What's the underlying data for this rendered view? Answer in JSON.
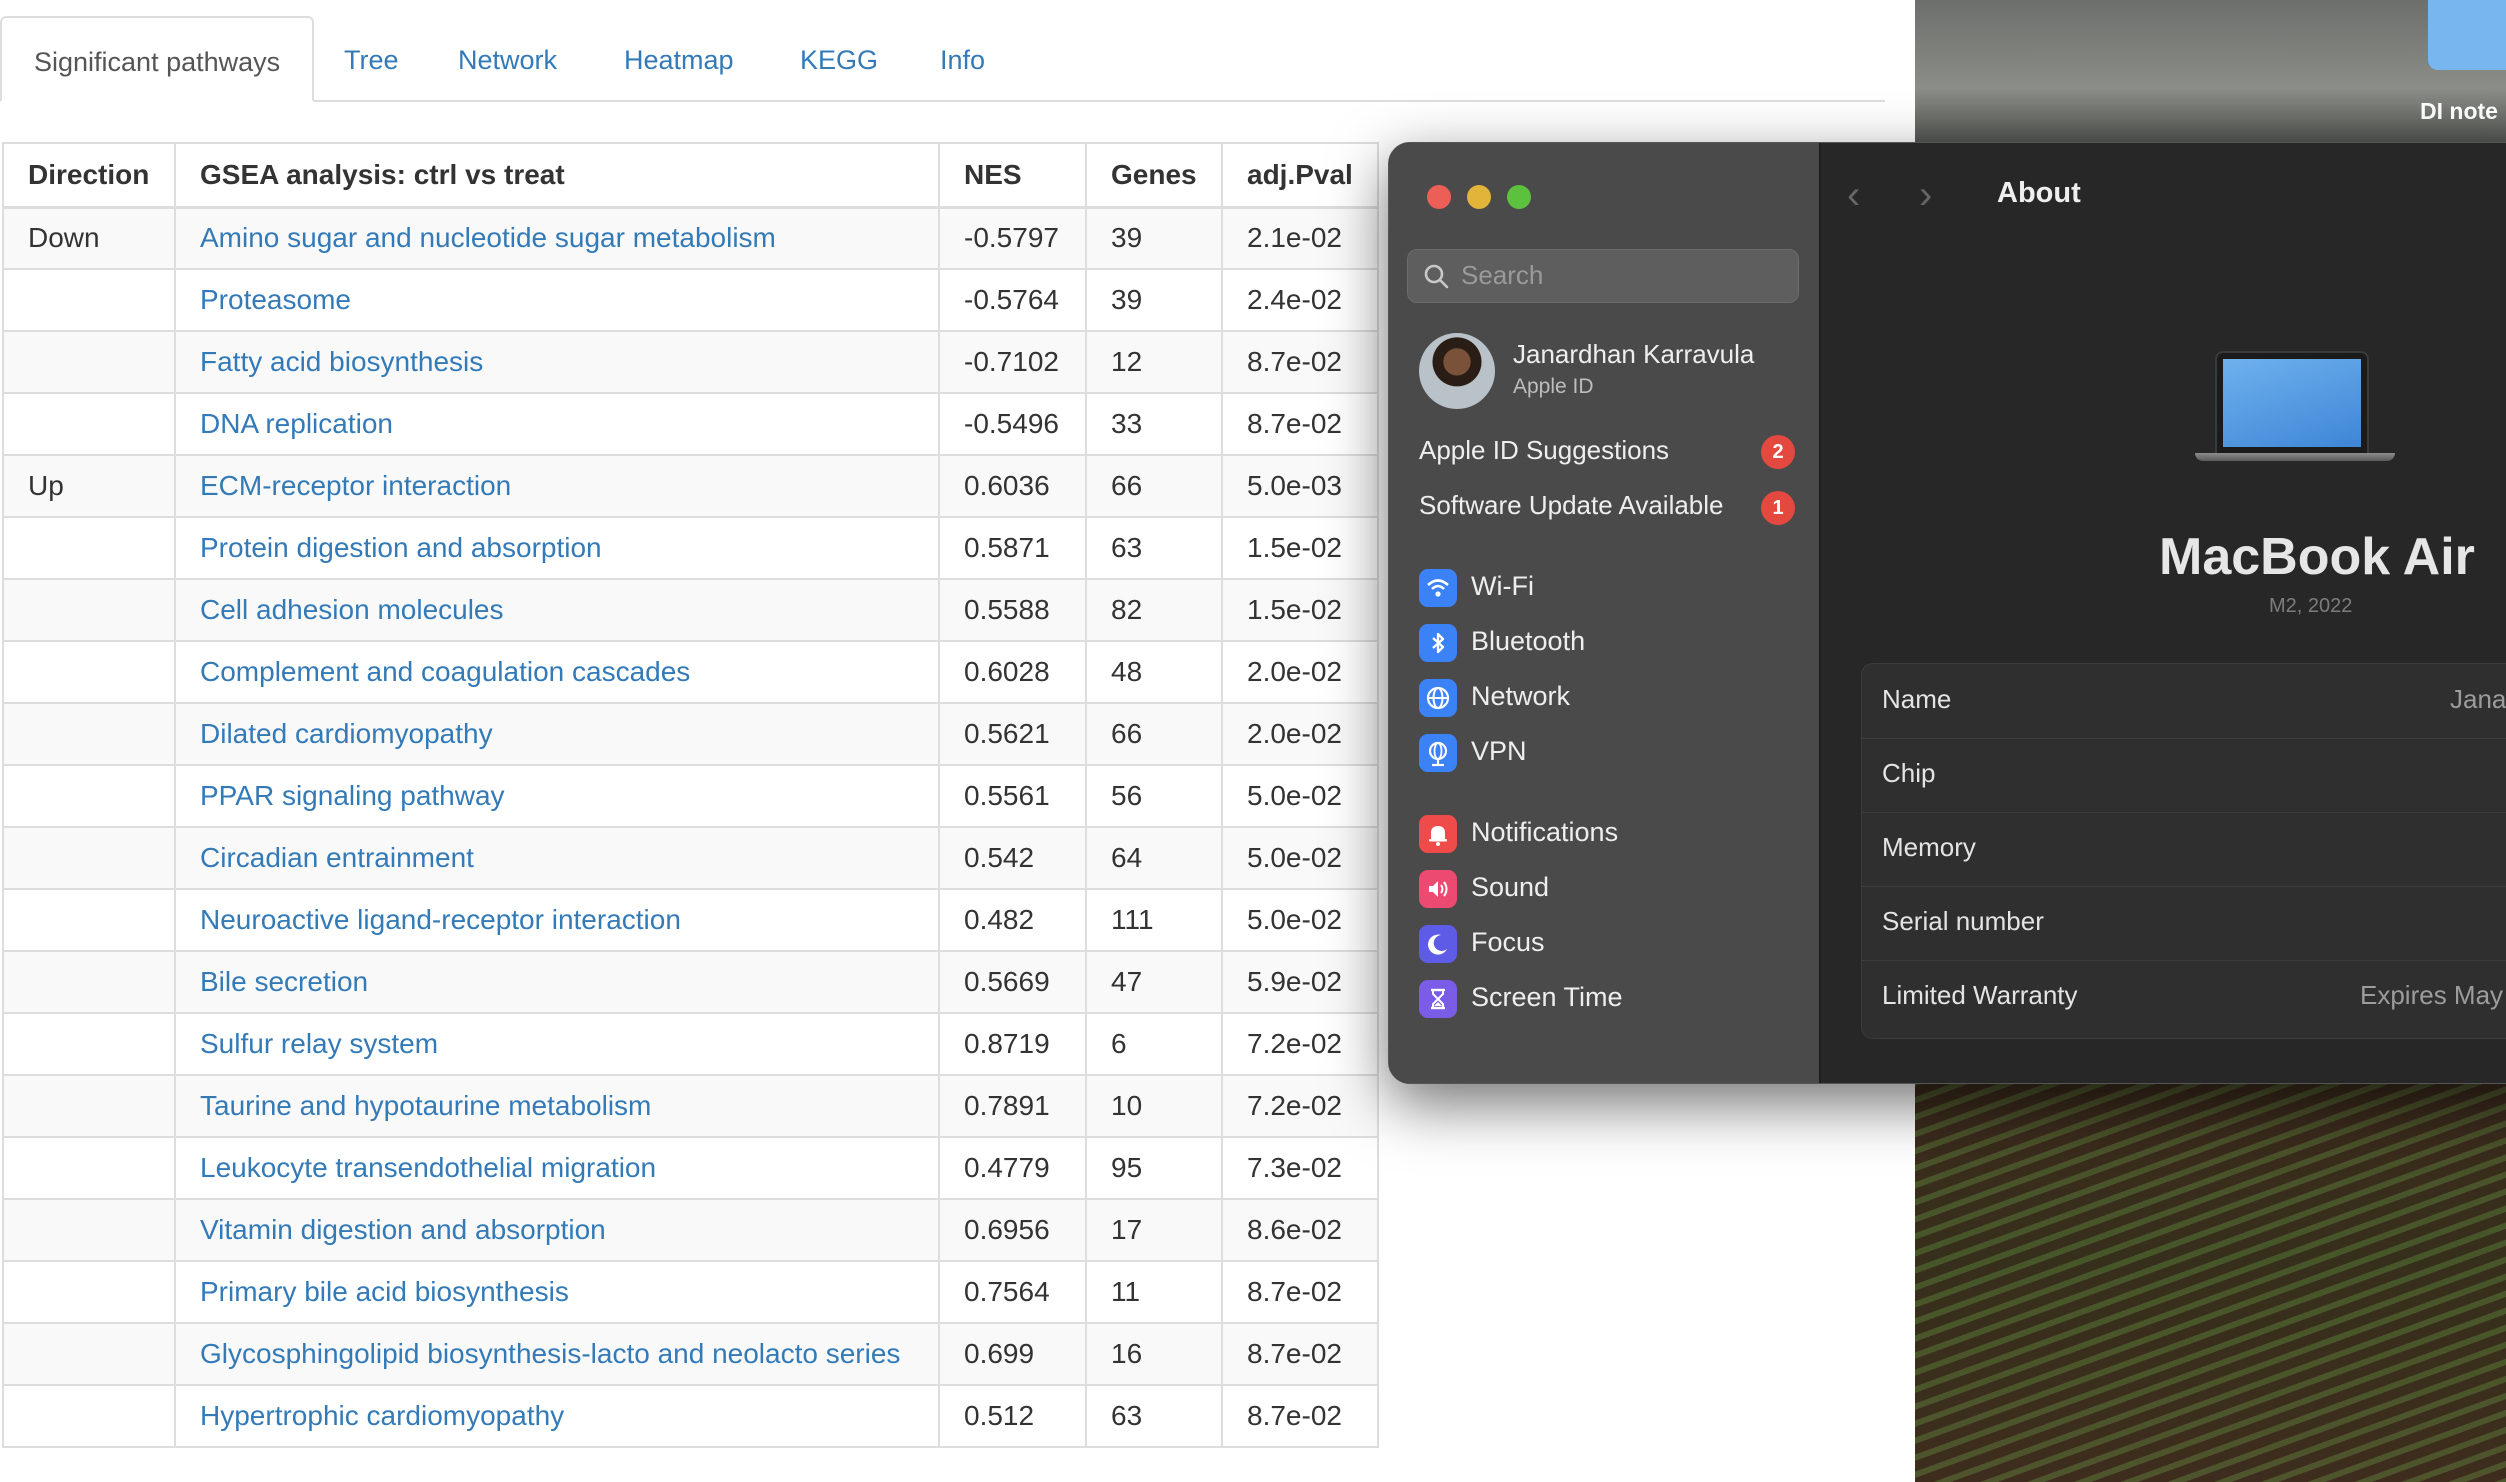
{
  "tabs": [
    "Significant pathways",
    "Tree",
    "Network",
    "Heatmap",
    "KEGG",
    "Info"
  ],
  "table": {
    "headers": [
      "Direction",
      "GSEA analysis: ctrl vs treat",
      "NES",
      "Genes",
      "adj.Pval"
    ],
    "rows": [
      [
        "Down",
        "Amino sugar and nucleotide sugar metabolism",
        "-0.5797",
        "39",
        "2.1e-02"
      ],
      [
        "",
        "Proteasome",
        "-0.5764",
        "39",
        "2.4e-02"
      ],
      [
        "",
        "Fatty acid biosynthesis",
        "-0.7102",
        "12",
        "8.7e-02"
      ],
      [
        "",
        "DNA replication",
        "-0.5496",
        "33",
        "8.7e-02"
      ],
      [
        "Up",
        "ECM-receptor interaction",
        "0.6036",
        "66",
        "5.0e-03"
      ],
      [
        "",
        "Protein digestion and absorption",
        "0.5871",
        "63",
        "1.5e-02"
      ],
      [
        "",
        "Cell adhesion molecules",
        "0.5588",
        "82",
        "1.5e-02"
      ],
      [
        "",
        "Complement and coagulation cascades",
        "0.6028",
        "48",
        "2.0e-02"
      ],
      [
        "",
        "Dilated cardiomyopathy",
        "0.5621",
        "66",
        "2.0e-02"
      ],
      [
        "",
        "PPAR signaling pathway",
        "0.5561",
        "56",
        "5.0e-02"
      ],
      [
        "",
        "Circadian entrainment",
        "0.542",
        "64",
        "5.0e-02"
      ],
      [
        "",
        "Neuroactive ligand-receptor interaction",
        "0.482",
        "111",
        "5.0e-02"
      ],
      [
        "",
        "Bile secretion",
        "0.5669",
        "47",
        "5.9e-02"
      ],
      [
        "",
        "Sulfur relay system",
        "0.8719",
        "6",
        "7.2e-02"
      ],
      [
        "",
        "Taurine and hypotaurine metabolism",
        "0.7891",
        "10",
        "7.2e-02"
      ],
      [
        "",
        "Leukocyte transendothelial migration",
        "0.4779",
        "95",
        "7.3e-02"
      ],
      [
        "",
        "Vitamin digestion and absorption",
        "0.6956",
        "17",
        "8.6e-02"
      ],
      [
        "",
        "Primary bile acid biosynthesis",
        "0.7564",
        "11",
        "8.7e-02"
      ],
      [
        "",
        "Glycosphingolipid biosynthesis-lacto and neolacto series",
        "0.699",
        "16",
        "8.7e-02"
      ],
      [
        "",
        "Hypertrophic cardiomyopathy",
        "0.512",
        "63",
        "8.7e-02"
      ]
    ]
  },
  "desktop": {
    "folder_label": "DI note"
  },
  "settings": {
    "search_placeholder": "Search",
    "user": {
      "name": "Janardhan Karravula",
      "subtitle": "Apple ID"
    },
    "notices": [
      {
        "label": "Apple ID Suggestions",
        "badge": "2"
      },
      {
        "label": "Software Update Available",
        "badge": "1"
      }
    ],
    "group1": [
      {
        "label": "Wi-Fi",
        "icon": "wifi-icon",
        "color": "#3b82f6"
      },
      {
        "label": "Bluetooth",
        "icon": "bluetooth-icon",
        "color": "#3b82f6"
      },
      {
        "label": "Network",
        "icon": "globe-icon",
        "color": "#3b82f6"
      },
      {
        "label": "VPN",
        "icon": "vpn-globe-icon",
        "color": "#3b82f6"
      }
    ],
    "group2": [
      {
        "label": "Notifications",
        "icon": "bell-icon",
        "color": "#ef4b4b"
      },
      {
        "label": "Sound",
        "icon": "speaker-icon",
        "color": "#ec4a71"
      },
      {
        "label": "Focus",
        "icon": "moon-icon",
        "color": "#5e5ce6"
      },
      {
        "label": "Screen Time",
        "icon": "hourglass-icon",
        "color": "#7a5ce6"
      }
    ],
    "pane": {
      "title": "About",
      "model": "MacBook Air",
      "model_sub": "M2, 2022",
      "rows": [
        {
          "label": "Name",
          "value": "Jana"
        },
        {
          "label": "Chip",
          "value": ""
        },
        {
          "label": "Memory",
          "value": ""
        },
        {
          "label": "Serial number",
          "value": ""
        },
        {
          "label": "Limited Warranty",
          "value": "Expires May"
        }
      ]
    }
  }
}
